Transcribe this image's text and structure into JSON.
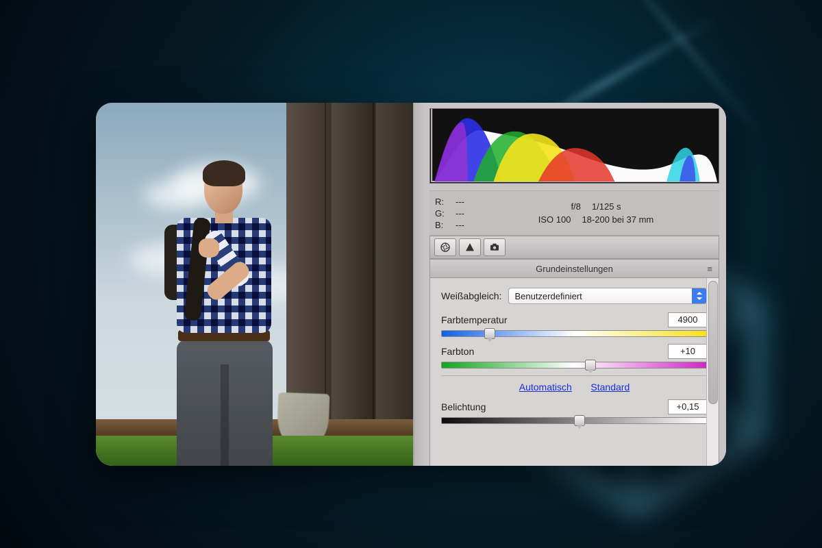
{
  "info": {
    "rgb": {
      "r_label": "R:",
      "g_label": "G:",
      "b_label": "B:",
      "r_val": "---",
      "g_val": "---",
      "b_val": "---"
    },
    "exif": {
      "aperture": "f/8",
      "shutter": "1/125 s",
      "iso": "ISO 100",
      "lens": "18-200 bei 37 mm"
    }
  },
  "panel": {
    "header": "Grundeinstellungen",
    "wb_label": "Weißabgleich:",
    "wb_value": "Benutzerdefiniert",
    "temp_label": "Farbtemperatur",
    "temp_value": "4900",
    "tint_label": "Farbton",
    "tint_value": "+10",
    "auto_link": "Automatisch",
    "default_link": "Standard",
    "exposure_label": "Belichtung",
    "exposure_value": "+0,15"
  },
  "slider_pos": {
    "temp": 18,
    "tint": 56,
    "exposure": 52
  }
}
